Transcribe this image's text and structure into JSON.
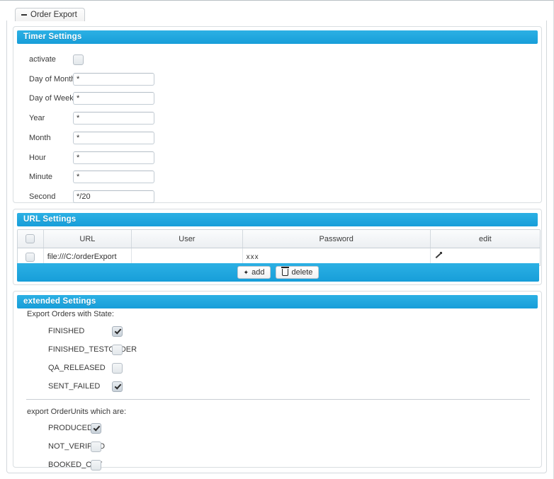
{
  "tab": {
    "label": "Order Export",
    "collapse_icon": "minus-icon"
  },
  "timer_settings": {
    "title": "Timer Settings",
    "activate": {
      "label": "activate",
      "checked": false
    },
    "fields": [
      {
        "label": "Day of Month",
        "value": "*"
      },
      {
        "label": "Day of Week",
        "value": "*"
      },
      {
        "label": "Year",
        "value": "*"
      },
      {
        "label": "Month",
        "value": "*"
      },
      {
        "label": "Hour",
        "value": "*"
      },
      {
        "label": "Minute",
        "value": "*"
      },
      {
        "label": "Second",
        "value": "*/20"
      }
    ]
  },
  "url_settings": {
    "title": "URL Settings",
    "columns": [
      "",
      "URL",
      "User",
      "Password",
      "edit"
    ],
    "rows": [
      {
        "selected": false,
        "url": "file:///C:/orderExport",
        "user": "",
        "password": "xxx",
        "edit_icon": "pencil-icon"
      }
    ],
    "buttons": {
      "add": "add",
      "delete": "delete"
    }
  },
  "extended_settings": {
    "title": "extended Settings",
    "orders_group": {
      "heading": "Export Orders with State:",
      "items": [
        {
          "label": "FINISHED",
          "checked": true
        },
        {
          "label": "FINISHED_TESTORDER",
          "checked": false
        },
        {
          "label": "QA_RELEASED",
          "checked": false
        },
        {
          "label": "SENT_FAILED",
          "checked": true
        }
      ]
    },
    "units_group": {
      "heading": "export OrderUnits which are:",
      "items": [
        {
          "label": "PRODUCED",
          "checked": true
        },
        {
          "label": "NOT_VERIFIED",
          "checked": false
        },
        {
          "label": "BOOKED_OUT",
          "checked": false
        }
      ]
    }
  },
  "colors": {
    "accent": "#1f9fd9",
    "panel_border": "#d9dee1",
    "text": "#333333"
  }
}
